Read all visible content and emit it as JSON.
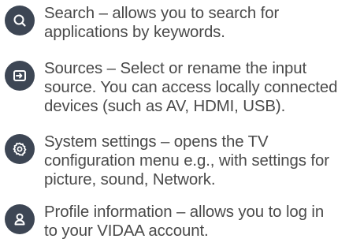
{
  "items": [
    {
      "icon": "search-icon",
      "lines": [
        "Search – allows you to search for",
        "applications by keywords."
      ]
    },
    {
      "icon": "input-source-icon",
      "lines": [
        "Sources – Select or rename the input",
        "source. You can access locally connected",
        "devices (such as AV, HDMI, USB)."
      ]
    },
    {
      "icon": "gear-icon",
      "lines": [
        "System settings – opens the TV",
        "configuration menu e.g., with settings for",
        "picture, sound, Network."
      ]
    },
    {
      "icon": "profile-icon",
      "lines": [
        "Profile information – allows you to log in",
        "to your VIDAA account."
      ]
    }
  ],
  "colors": {
    "badge": "#3d4654",
    "glyph": "#ffffff",
    "text": "#4a4a4a"
  }
}
